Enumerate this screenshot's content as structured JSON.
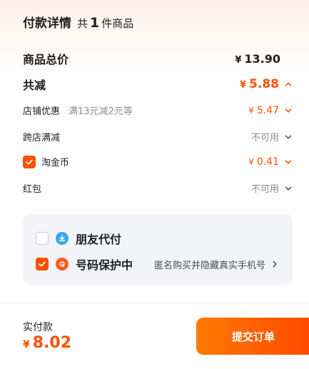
{
  "header": {
    "title": "付款详情",
    "count_prefix": "共",
    "count": "1",
    "count_suffix": "件商品"
  },
  "summary": {
    "total_label": "商品总价",
    "total_currency": "¥",
    "total_value": "13.90",
    "discount_label": "共减",
    "discount_currency": "¥",
    "discount_value": "5.88"
  },
  "discounts": [
    {
      "label": "店铺优惠",
      "detail": "满13元减2元等",
      "currency": "¥",
      "value": "5.47"
    },
    {
      "label": "跨店满减",
      "status": "不可用"
    },
    {
      "label": "淘金币",
      "currency": "¥",
      "value": "0.41",
      "checked": true
    },
    {
      "label": "红包",
      "status": "不可用"
    }
  ],
  "panel": {
    "friend_pay_label": "朋友代付",
    "friend_pay_checked": false,
    "privacy_label": "号码保护中",
    "privacy_checked": true,
    "privacy_hint": "匿名购买并隐藏真实手机号"
  },
  "footer": {
    "actual_label": "实付款",
    "currency": "¥",
    "actual_value": "8.02",
    "submit_label": "提交订单"
  },
  "colors": {
    "accent": "#ff5000",
    "panel_bg": "#f3f4f8",
    "friend_icon": "#38a8e8",
    "privacy_icon": "#ff5a1f"
  },
  "icons": {
    "chevron_up": "chevron-up-icon",
    "chevron_down": "chevron-down-icon",
    "chevron_right": "chevron-right-icon",
    "checkmark": "checkmark-icon",
    "friend_pay": "friend-pay-icon",
    "privacy": "privacy-shield-icon"
  }
}
